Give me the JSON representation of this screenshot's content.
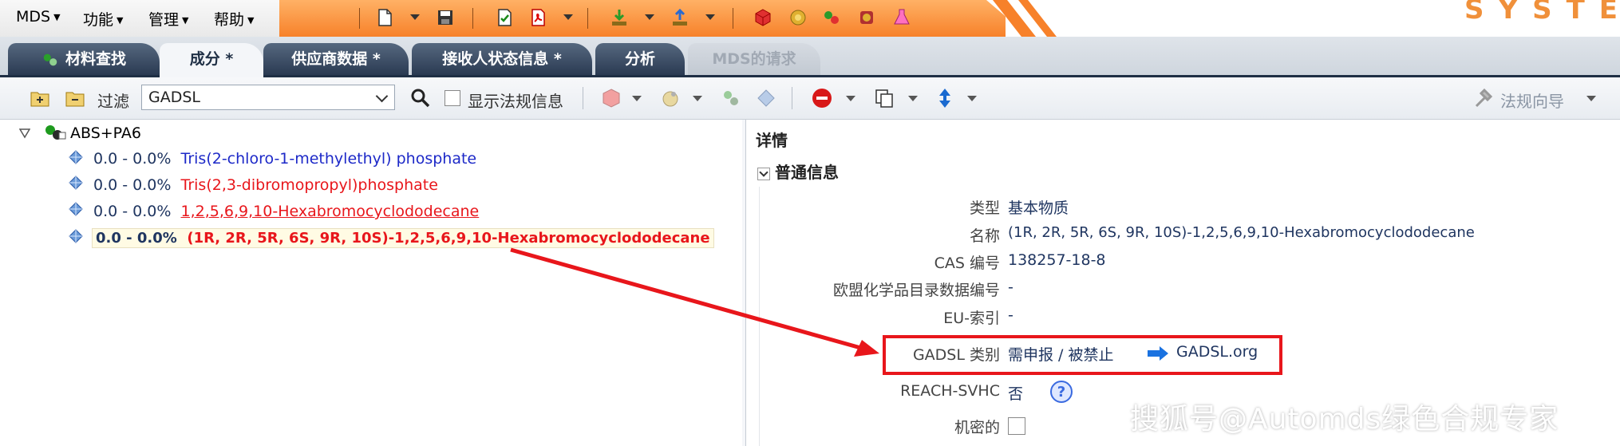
{
  "brand": "SYSTEM",
  "menu": [
    {
      "label": "MDS"
    },
    {
      "label": "功能"
    },
    {
      "label": "管理"
    },
    {
      "label": "帮助"
    }
  ],
  "tabs": [
    {
      "label": "材料查找",
      "state": "normal"
    },
    {
      "label": "成分 *",
      "state": "active"
    },
    {
      "label": "供应商数据 *",
      "state": "normal"
    },
    {
      "label": "接收人状态信息 *",
      "state": "normal"
    },
    {
      "label": "分析",
      "state": "normal"
    },
    {
      "label": "MDS的请求",
      "state": "disabled"
    }
  ],
  "filter": {
    "label": "过滤",
    "selected": "GADSL",
    "show_regulation_label": "显示法规信息",
    "wizard_label": "法规向导"
  },
  "tree": {
    "root": "ABS+PA6",
    "items": [
      {
        "range": "0.0 - 0.0%",
        "name": "Tris(2-chloro-1-methylethyl) phosphate",
        "color": "#1d29c8"
      },
      {
        "range": "0.0 - 0.0%",
        "name": "Tris(2,3-dibromopropyl)phosphate",
        "color": "#e8161b"
      },
      {
        "range": "0.0 - 0.0%",
        "name": "1,2,5,6,9,10-Hexabromocyclododecane",
        "color": "#e8161b"
      },
      {
        "range": "0.0 - 0.0%",
        "name": "(1R, 2R, 5R, 6S, 9R, 10S)-1,2,5,6,9,10-Hexabromocyclododecane",
        "color": "#e8161b"
      }
    ]
  },
  "details": {
    "title": "详情",
    "section": "普通信息",
    "fields": [
      {
        "label": "类型",
        "value": "基本物质"
      },
      {
        "label": "名称",
        "value": "(1R, 2R, 5R, 6S, 9R, 10S)-1,2,5,6,9,10-Hexabromocyclododecane"
      },
      {
        "label": "CAS 编号",
        "value": "138257-18-8"
      },
      {
        "label": "欧盟化学品目录数据编号",
        "value": "-"
      },
      {
        "label": "EU-索引",
        "value": "-"
      },
      {
        "label": "GADSL 类别",
        "value": "需申报 / 被禁止",
        "link": "GADSL.org"
      },
      {
        "label": "REACH-SVHC",
        "value": "否"
      },
      {
        "label": "机密的",
        "value": ""
      }
    ]
  },
  "watermark": "搜狐号@Automds绿色合规专家",
  "colors": {
    "accent": "#f7812a",
    "tab_dark": "#2a3a52",
    "highlight": "#e8161b"
  }
}
